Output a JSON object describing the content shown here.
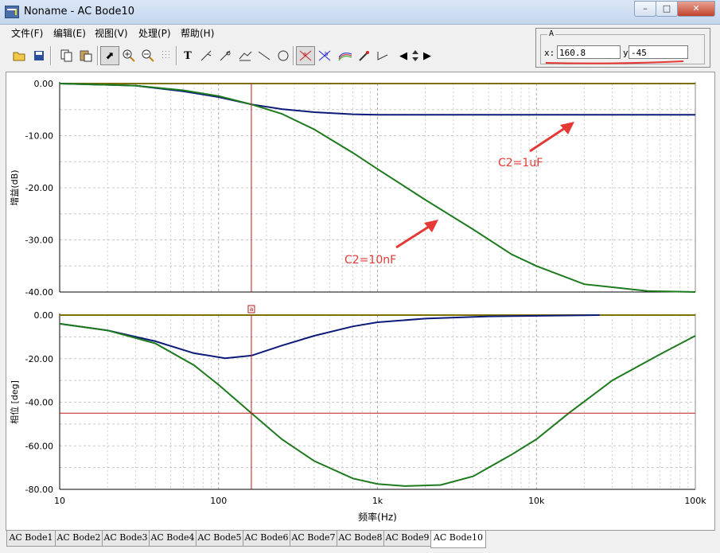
{
  "window": {
    "title": "Noname - AC Bode10"
  },
  "menu": [
    "文件(F)",
    "编辑(E)",
    "视图(V)",
    "处理(P)",
    "帮助(H)"
  ],
  "cursor": {
    "group": "A",
    "x_label": "x:",
    "x_value": "160.8",
    "y_label": "y:",
    "y_value": "-45"
  },
  "tabs": [
    "AC Bode1",
    "AC Bode2",
    "AC Bode3",
    "AC Bode4",
    "AC Bode5",
    "AC Bode6",
    "AC Bode7",
    "AC Bode8",
    "AC Bode9",
    "AC Bode10"
  ],
  "active_tab": 9,
  "colors": {
    "series_1uF": "#0c1a78",
    "series_10nF": "#1e7a1e",
    "cursor": "#b71c1c",
    "baseline": "#7c7000",
    "annotation": "#e53935"
  },
  "chart_data": [
    {
      "type": "line",
      "xscale": "log",
      "xlim": [
        10,
        100000
      ],
      "ylim": [
        -40,
        0
      ],
      "yticks": [
        "0.00",
        "-10.00",
        "-20.00",
        "-30.00",
        "-40.00"
      ],
      "ytick_values": [
        0,
        -10,
        -20,
        -30,
        -40
      ],
      "ylabel": "增益(dB)",
      "series": [
        {
          "name": "C2=1uF",
          "x": [
            10,
            30,
            60,
            100,
            160.8,
            250,
            400,
            700,
            1000,
            10000,
            100000
          ],
          "y": [
            0,
            -0.4,
            -1.5,
            -2.6,
            -4.0,
            -4.9,
            -5.5,
            -5.9,
            -6.0,
            -6.0,
            -6.0
          ]
        },
        {
          "name": "C2=10nF",
          "x": [
            10,
            30,
            60,
            100,
            160.8,
            250,
            400,
            700,
            1000,
            2000,
            4000,
            7000,
            10000,
            20000,
            50000,
            100000
          ],
          "y": [
            0,
            -0.4,
            -1.3,
            -2.4,
            -4.0,
            -5.8,
            -8.8,
            -13.3,
            -16.4,
            -22.3,
            -28.0,
            -32.8,
            -35.0,
            -38.5,
            -39.8,
            -40.0
          ]
        }
      ],
      "annotations": [
        {
          "text": "C2=1uF"
        },
        {
          "text": "C2=10nF"
        }
      ]
    },
    {
      "type": "line",
      "xscale": "log",
      "xlim": [
        10,
        100000
      ],
      "ylim": [
        -80,
        0
      ],
      "yticks": [
        "0.00",
        "-20.00",
        "-40.00",
        "-60.00",
        "-80.00"
      ],
      "ytick_values": [
        0,
        -20,
        -40,
        -60,
        -80
      ],
      "xticks": [
        "10",
        "100",
        "1k",
        "10k",
        "100k"
      ],
      "xtick_values": [
        10,
        100,
        1000,
        10000,
        100000
      ],
      "xlabel": "频率(Hz)",
      "ylabel": "相位 [deg]",
      "cursor_marker": "a",
      "series": [
        {
          "name": "C2=1uF",
          "x": [
            10,
            20,
            40,
            70,
            110,
            160.8,
            250,
            400,
            700,
            1000,
            2000,
            5000,
            25000
          ],
          "y": [
            -4,
            -7,
            -12,
            -17.5,
            -19.8,
            -18.6,
            -14,
            -9.5,
            -5.2,
            -3.3,
            -1.6,
            -0.6,
            0
          ]
        },
        {
          "name": "C2=10nF",
          "x": [
            10,
            20,
            40,
            70,
            100,
            160.8,
            250,
            400,
            700,
            1000,
            1500,
            2500,
            4000,
            7000,
            10000,
            16000,
            30000,
            60000,
            100000
          ],
          "y": [
            -4,
            -7,
            -13,
            -23,
            -32,
            -45,
            -57,
            -67,
            -75,
            -77.5,
            -78.5,
            -78,
            -74,
            -64,
            -57,
            -45,
            -30,
            -18,
            -9.5
          ]
        }
      ]
    }
  ]
}
